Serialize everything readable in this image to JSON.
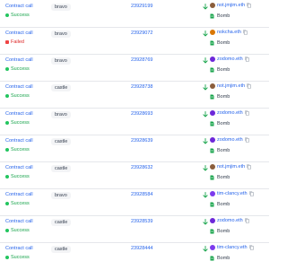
{
  "colors": {
    "link": "#2563eb",
    "success": "#16a34a",
    "failed": "#dc2626",
    "arrow": "#16a34a",
    "contract": "#16a34a"
  },
  "rows": [
    {
      "type": "Contract call",
      "status": "Success",
      "status_kind": "success",
      "method": "bravo",
      "block": "23929199",
      "from": "not.jmjim.eth",
      "from_avatar": "#8b5e3c",
      "to": "Bomb"
    },
    {
      "type": "Contract call",
      "status": "Failed",
      "status_kind": "failed",
      "method": "bravo",
      "block": "23929072",
      "from": "nokcha.eth",
      "from_avatar": "#d97706",
      "to": "Bomb"
    },
    {
      "type": "Contract call",
      "status": "Success",
      "status_kind": "success",
      "method": "bravo",
      "block": "23928769",
      "from": "zodomo.eth",
      "from_avatar": "#6d28d9",
      "to": "Bomb"
    },
    {
      "type": "Contract call",
      "status": "Success",
      "status_kind": "success",
      "method": "castle",
      "block": "23928738",
      "from": "not.jmjim.eth",
      "from_avatar": "#8b5e3c",
      "to": "Bomb"
    },
    {
      "type": "Contract call",
      "status": "Success",
      "status_kind": "success",
      "method": "bravo",
      "block": "23928693",
      "from": "zodomo.eth",
      "from_avatar": "#6d28d9",
      "to": "Bomb"
    },
    {
      "type": "Contract call",
      "status": "Success",
      "status_kind": "success",
      "method": "castle",
      "block": "23928639",
      "from": "zodomo.eth",
      "from_avatar": "#6d28d9",
      "to": "Bomb"
    },
    {
      "type": "Contract call",
      "status": "Success",
      "status_kind": "success",
      "method": "castle",
      "block": "23928632",
      "from": "not.jmjim.eth",
      "from_avatar": "#8b5e3c",
      "to": "Bomb"
    },
    {
      "type": "Contract call",
      "status": "Success",
      "status_kind": "success",
      "method": "bravo",
      "block": "23928584",
      "from": "tim-clancy.eth",
      "from_avatar": "#7c3aed",
      "to": "Bomb"
    },
    {
      "type": "Contract call",
      "status": "Success",
      "status_kind": "success",
      "method": "castle",
      "block": "23928539",
      "from": "zodomo.eth",
      "from_avatar": "#6d28d9",
      "to": "Bomb"
    },
    {
      "type": "Contract call",
      "status": "Success",
      "status_kind": "success",
      "method": "castle",
      "block": "23928444",
      "from": "tim-clancy.eth",
      "from_avatar": "#7c3aed",
      "to": "Bomb"
    }
  ]
}
